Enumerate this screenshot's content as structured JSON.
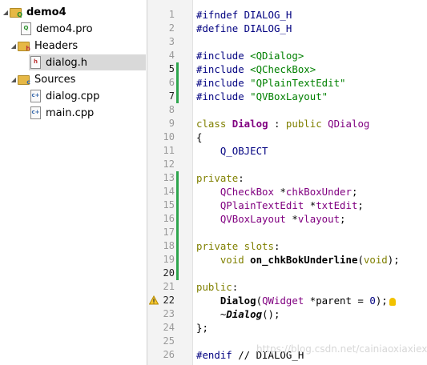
{
  "project_tree": {
    "root": {
      "label": "demo4",
      "icon": "project-folder-icon"
    },
    "items": [
      {
        "label": "demo4.pro",
        "icon": "pro-file-icon"
      },
      {
        "label": "Headers",
        "icon": "headers-folder-icon"
      },
      {
        "label": "dialog.h",
        "icon": "header-file-icon",
        "selected": true
      },
      {
        "label": "Sources",
        "icon": "sources-folder-icon"
      },
      {
        "label": "dialog.cpp",
        "icon": "cpp-file-icon"
      },
      {
        "label": "main.cpp",
        "icon": "cpp-file-icon"
      }
    ]
  },
  "editor": {
    "lines": [
      {
        "n": "1",
        "segs": [
          {
            "t": "#ifndef DIALOG_H",
            "c": "pre"
          }
        ]
      },
      {
        "n": "2",
        "segs": [
          {
            "t": "#define DIALOG_H",
            "c": "pre"
          }
        ]
      },
      {
        "n": "3",
        "segs": []
      },
      {
        "n": "4",
        "segs": [
          {
            "t": "#include ",
            "c": "pre"
          },
          {
            "t": "<QDialog>",
            "c": "str"
          }
        ]
      },
      {
        "n": "5",
        "segs": [
          {
            "t": "#include ",
            "c": "pre"
          },
          {
            "t": "<QCheckBox>",
            "c": "str"
          }
        ]
      },
      {
        "n": "6",
        "segs": [
          {
            "t": "#include ",
            "c": "pre"
          },
          {
            "t": "\"QPlainTextEdit\"",
            "c": "str"
          }
        ]
      },
      {
        "n": "7",
        "segs": [
          {
            "t": "#include ",
            "c": "pre"
          },
          {
            "t": "\"QVBoxLayout\"",
            "c": "str"
          }
        ]
      },
      {
        "n": "8",
        "segs": []
      },
      {
        "n": "9",
        "segs": [
          {
            "t": "class ",
            "c": "kw"
          },
          {
            "t": "Dialog",
            "c": "cls"
          },
          {
            "t": " : ",
            "c": ""
          },
          {
            "t": "public ",
            "c": "kw"
          },
          {
            "t": "QDialog",
            "c": "ty"
          }
        ]
      },
      {
        "n": "10",
        "segs": [
          {
            "t": "{",
            "c": ""
          }
        ]
      },
      {
        "n": "11",
        "segs": [
          {
            "t": "    Q_OBJECT",
            "c": "pre"
          }
        ]
      },
      {
        "n": "12",
        "segs": []
      },
      {
        "n": "13",
        "segs": [
          {
            "t": "private",
            "c": "kw"
          },
          {
            "t": ":",
            "c": ""
          }
        ]
      },
      {
        "n": "14",
        "segs": [
          {
            "t": "    QCheckBox",
            "c": "ty"
          },
          {
            "t": " *",
            "c": ""
          },
          {
            "t": "chkBoxUnder",
            "c": "ty"
          },
          {
            "t": ";",
            "c": ""
          }
        ]
      },
      {
        "n": "15",
        "segs": [
          {
            "t": "    QPlainTextEdit",
            "c": "ty"
          },
          {
            "t": " *",
            "c": ""
          },
          {
            "t": "txtEdit",
            "c": "ty"
          },
          {
            "t": ";",
            "c": ""
          }
        ]
      },
      {
        "n": "16",
        "segs": [
          {
            "t": "    QVBoxLayout",
            "c": "ty"
          },
          {
            "t": " *",
            "c": ""
          },
          {
            "t": "vlayout",
            "c": "ty"
          },
          {
            "t": ";",
            "c": ""
          }
        ]
      },
      {
        "n": "17",
        "segs": []
      },
      {
        "n": "18",
        "segs": [
          {
            "t": "private slots",
            "c": "kw"
          },
          {
            "t": ":",
            "c": ""
          }
        ]
      },
      {
        "n": "19",
        "segs": [
          {
            "t": "    ",
            "c": ""
          },
          {
            "t": "void",
            "c": "kw"
          },
          {
            "t": " ",
            "c": ""
          },
          {
            "t": "on_chkBokUnderline",
            "c": "fnb"
          },
          {
            "t": "(",
            "c": ""
          },
          {
            "t": "void",
            "c": "kw"
          },
          {
            "t": ");",
            "c": ""
          }
        ]
      },
      {
        "n": "20",
        "segs": []
      },
      {
        "n": "21",
        "segs": [
          {
            "t": "public",
            "c": "kw"
          },
          {
            "t": ":",
            "c": ""
          }
        ]
      },
      {
        "n": "22",
        "segs": [
          {
            "t": "    ",
            "c": ""
          },
          {
            "t": "Dialog",
            "c": "fnb"
          },
          {
            "t": "(",
            "c": ""
          },
          {
            "t": "QWidget",
            "c": "ty"
          },
          {
            "t": " *parent = ",
            "c": ""
          },
          {
            "t": "0",
            "c": "num"
          },
          {
            "t": ");",
            "c": ""
          }
        ]
      },
      {
        "n": "23",
        "segs": [
          {
            "t": "    ~",
            "c": ""
          },
          {
            "t": "Dialog",
            "c": "ital"
          },
          {
            "t": "();",
            "c": ""
          }
        ]
      },
      {
        "n": "24",
        "segs": [
          {
            "t": "};",
            "c": ""
          }
        ]
      },
      {
        "n": "25",
        "segs": []
      },
      {
        "n": "26",
        "segs": [
          {
            "t": "#endif ",
            "c": "pre"
          },
          {
            "t": "// DIALOG_H",
            "c": ""
          }
        ]
      }
    ],
    "current_lines": [
      "5",
      "7",
      "20",
      "22"
    ],
    "changed_ranges": [
      [
        "5",
        "7"
      ],
      [
        "13",
        "20"
      ]
    ],
    "warning_line": "22",
    "bulb_line": "22"
  },
  "watermark": "https://blog.csdn.net/cainiaoxiaxiexing",
  "colors": {
    "preprocessor": "#000080",
    "keyword": "#808000",
    "type": "#800080",
    "string": "#008000",
    "change_marker": "#2ea54d",
    "folder": "#e6b846"
  }
}
